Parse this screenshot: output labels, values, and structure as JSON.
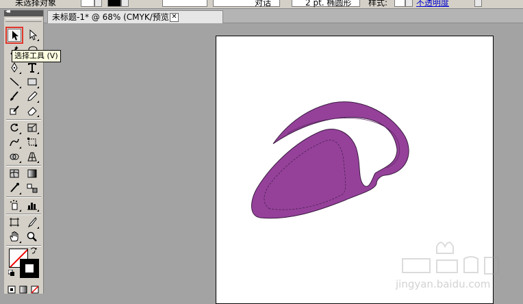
{
  "control_bar": {
    "fragment_left": "未选择对象",
    "fragment_mid": "对话",
    "fragment_right": "2 pt. 椭圆形",
    "style_label": "样式:",
    "link_fragment": "不透明度"
  },
  "document": {
    "tab_title": "未标题-1* @ 68% (CMYK/预览)",
    "close_glyph": "✕"
  },
  "toolbox": {
    "collapse_glyph": "◂◂",
    "tooltip": "选择工具 (V)"
  },
  "colors": {
    "shape_fill": "#95419a",
    "shape_stroke": "#3a1a40",
    "highlight_border": "#e0352b"
  },
  "watermark": {
    "text": "jingyan.baidu.com"
  }
}
